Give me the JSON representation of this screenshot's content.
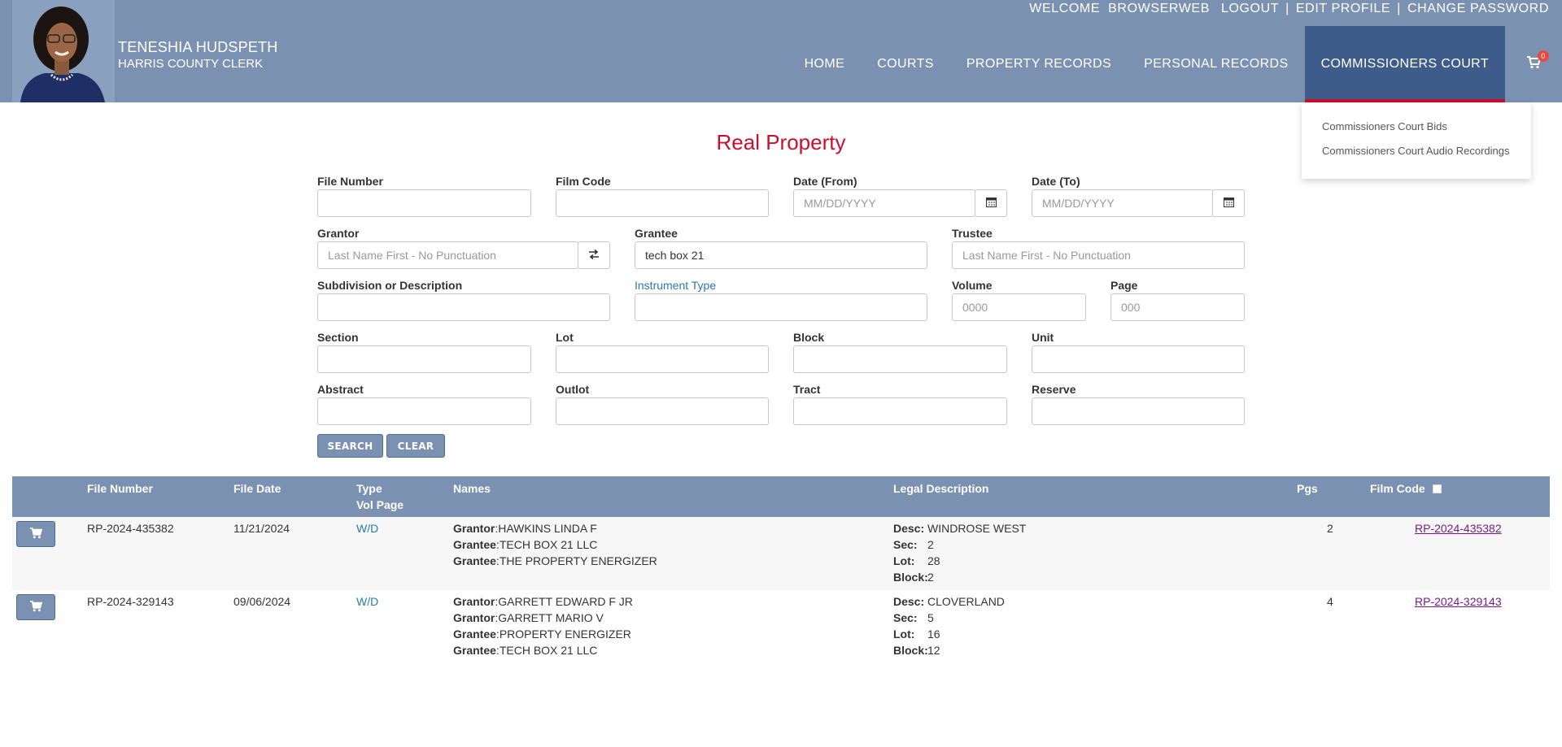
{
  "header": {
    "clerk_name": "TENESHIA HUDSPETH",
    "clerk_title": "HARRIS COUNTY CLERK",
    "top_links": [
      "WELCOME",
      "BROWSERWEB",
      "LOGOUT",
      "|",
      "EDIT PROFILE",
      "|",
      "CHANGE PASSWORD"
    ],
    "nav": [
      "HOME",
      "COURTS",
      "PROPERTY RECORDS",
      "PERSONAL RECORDS",
      "COMMISSIONERS COURT"
    ],
    "cart_count": "0",
    "colors": {
      "header_bg": "#7b91b1",
      "active_nav": "#3e5c8a",
      "accent_red": "#c8102e"
    }
  },
  "dropdown": {
    "items": [
      "Commissioners Court Bids",
      "Commissioners Court Audio Recordings"
    ]
  },
  "form": {
    "title": "Real Property",
    "file_number": {
      "label": "File Number",
      "value": ""
    },
    "film_code": {
      "label": "Film Code",
      "value": ""
    },
    "date_from": {
      "label": "Date (From)",
      "placeholder": "MM/DD/YYYY"
    },
    "date_to": {
      "label": "Date (To)",
      "placeholder": "MM/DD/YYYY"
    },
    "grantor": {
      "label": "Grantor",
      "placeholder": "Last Name First - No Punctuation"
    },
    "grantee": {
      "label": "Grantee",
      "value": "tech box 21"
    },
    "trustee": {
      "label": "Trustee",
      "placeholder": "Last Name First - No Punctuation"
    },
    "subdivision": {
      "label": "Subdivision or Description",
      "value": ""
    },
    "instrument_type": {
      "label": "Instrument Type",
      "value": ""
    },
    "volume": {
      "label": "Volume",
      "placeholder": "0000"
    },
    "page": {
      "label": "Page",
      "placeholder": "000"
    },
    "section": {
      "label": "Section"
    },
    "lot": {
      "label": "Lot"
    },
    "block": {
      "label": "Block"
    },
    "unit": {
      "label": "Unit"
    },
    "abstract": {
      "label": "Abstract"
    },
    "outlot": {
      "label": "Outlot"
    },
    "tract": {
      "label": "Tract"
    },
    "reserve": {
      "label": "Reserve"
    },
    "search_label": "SEARCH",
    "clear_label": "CLEAR"
  },
  "results": {
    "headers": {
      "file_number": "File Number",
      "file_date": "File Date",
      "type": "Type",
      "vol_page": "Vol Page",
      "names": "Names",
      "legal": "Legal Description",
      "pgs": "Pgs",
      "film_code": "Film Code"
    },
    "rows": [
      {
        "file_number": "RP-2024-435382",
        "file_date": "11/21/2024",
        "type": "W/D",
        "names": [
          {
            "role": "Grantor",
            "name": "HAWKINS LINDA F"
          },
          {
            "role": "Grantee",
            "name": "TECH BOX 21 LLC"
          },
          {
            "role": "Grantee",
            "name": "THE PROPERTY ENERGIZER"
          }
        ],
        "legal": [
          {
            "key": "Desc:",
            "value": "WINDROSE WEST"
          },
          {
            "key": "Sec:",
            "value": "2"
          },
          {
            "key": "Lot:",
            "value": "28"
          },
          {
            "key": "Block:",
            "value": "2"
          }
        ],
        "pgs": "2",
        "film_code": "RP-2024-435382"
      },
      {
        "file_number": "RP-2024-329143",
        "file_date": "09/06/2024",
        "type": "W/D",
        "names": [
          {
            "role": "Grantor",
            "name": "GARRETT EDWARD F JR"
          },
          {
            "role": "Grantor",
            "name": "GARRETT MARIO V"
          },
          {
            "role": "Grantee",
            "name": "PROPERTY ENERGIZER"
          },
          {
            "role": "Grantee",
            "name": "TECH BOX 21 LLC"
          }
        ],
        "legal": [
          {
            "key": "Desc:",
            "value": "CLOVERLAND"
          },
          {
            "key": "Sec:",
            "value": "5"
          },
          {
            "key": "Lot:",
            "value": "16"
          },
          {
            "key": "Block:",
            "value": "12"
          }
        ],
        "pgs": "4",
        "film_code": "RP-2024-329143"
      }
    ]
  }
}
